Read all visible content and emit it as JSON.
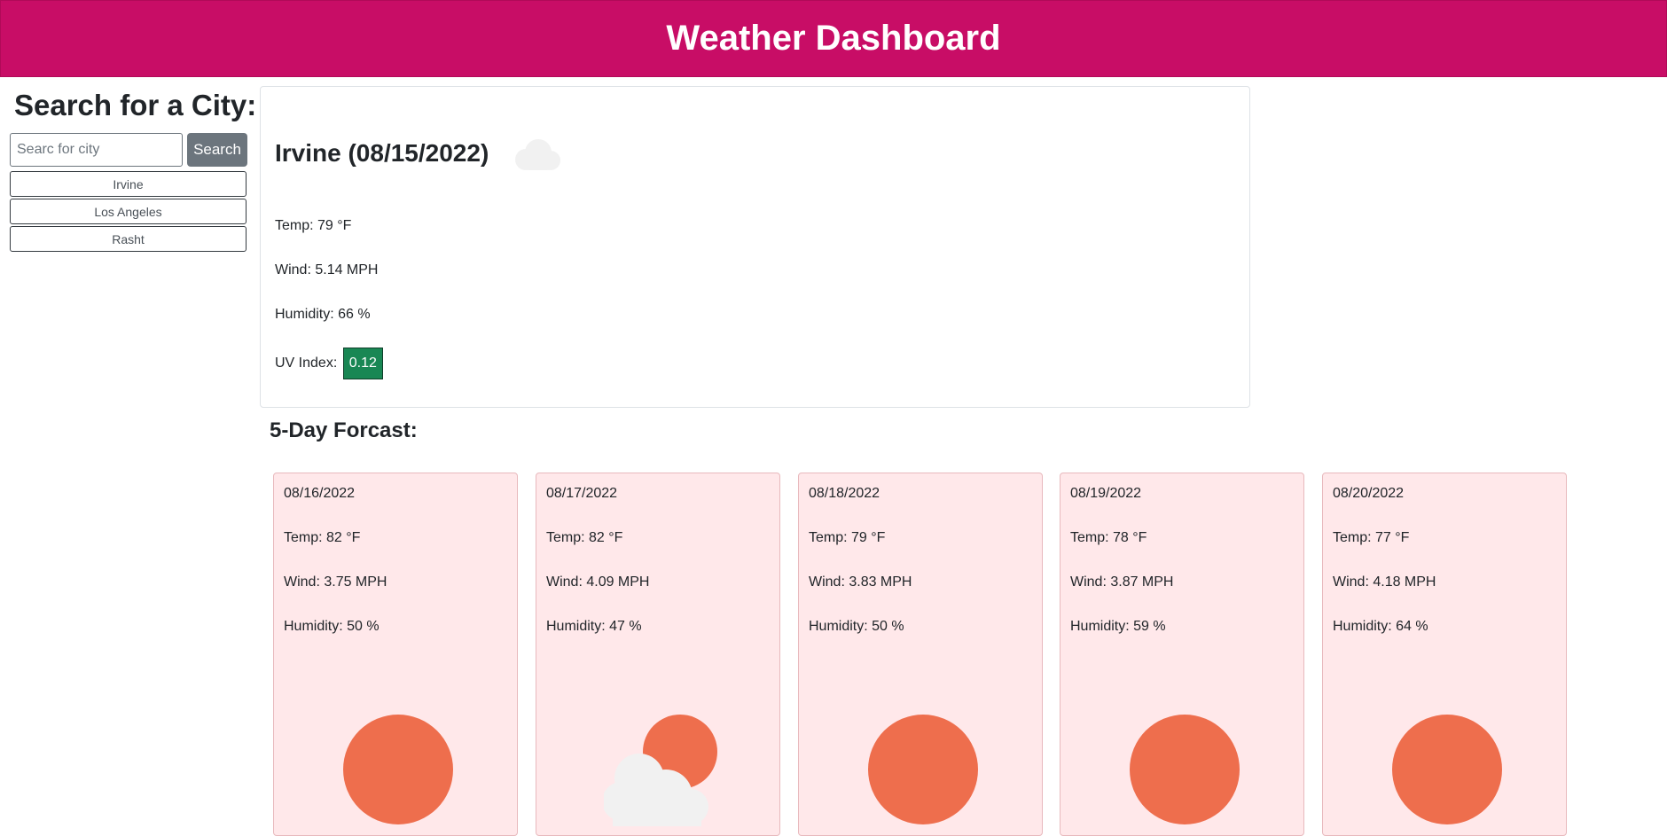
{
  "header": {
    "title": "Weather Dashboard"
  },
  "sidebar": {
    "heading": "Search for a City:",
    "search_placeholder": "Searc for city",
    "search_label": "Search",
    "history": [
      "Irvine",
      "Los Angeles",
      "Rasht"
    ]
  },
  "current": {
    "title": "Irvine (08/15/2022)",
    "icon": "cloud-icon",
    "temp": "Temp: 79 °F",
    "wind": "Wind: 5.14 MPH",
    "humidity": "Humidity: 66 %",
    "uv_label": "UV Index:",
    "uv_value": "0.12",
    "uv_color": "#198754"
  },
  "forecast": {
    "title": "5-Day Forcast:",
    "days": [
      {
        "date": "08/16/2022",
        "temp": "Temp: 82 °F",
        "wind": "Wind: 3.75 MPH",
        "humidity": "Humidity: 50 %",
        "icon": "sun-icon"
      },
      {
        "date": "08/17/2022",
        "temp": "Temp: 82 °F",
        "wind": "Wind: 4.09 MPH",
        "humidity": "Humidity: 47 %",
        "icon": "partly-cloudy-icon"
      },
      {
        "date": "08/18/2022",
        "temp": "Temp: 79 °F",
        "wind": "Wind: 3.83 MPH",
        "humidity": "Humidity: 50 %",
        "icon": "sun-icon"
      },
      {
        "date": "08/19/2022",
        "temp": "Temp: 78 °F",
        "wind": "Wind: 3.87 MPH",
        "humidity": "Humidity: 59 %",
        "icon": "sun-icon"
      },
      {
        "date": "08/20/2022",
        "temp": "Temp: 77 °F",
        "wind": "Wind: 4.18 MPH",
        "humidity": "Humidity: 64 %",
        "icon": "sun-icon"
      }
    ]
  },
  "colors": {
    "header": "#c80d66",
    "card_bg": "#ffe8ea",
    "sun": "#ee6e4d",
    "cloud": "#f1f1f1"
  }
}
